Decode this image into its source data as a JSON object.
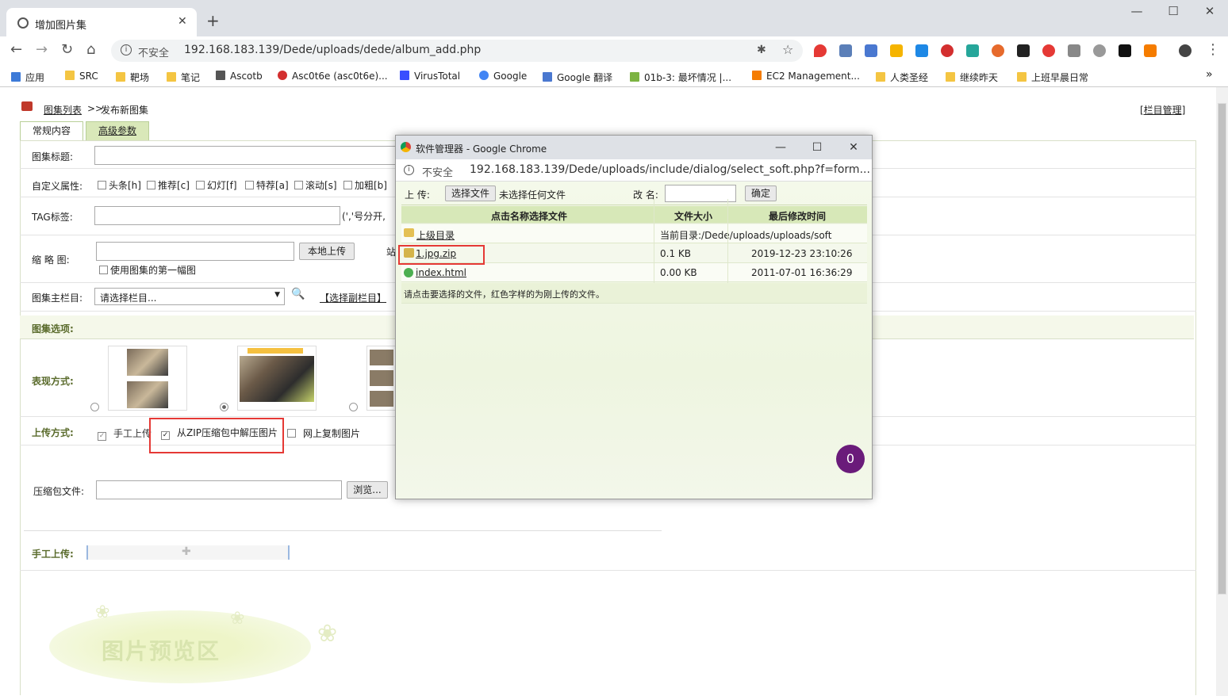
{
  "browser": {
    "tab_title": "增加图片集",
    "new_tab": "+",
    "win_min": "—",
    "win_max": "☐",
    "win_close": "✕",
    "security": "不安全",
    "url": "192.168.183.139/Dede/uploads/dede/album_add.php",
    "bookmarks": [
      "应用",
      "SRC",
      "靶场",
      "笔记",
      "Ascotb",
      "Asc0t6e (asc0t6e)...",
      "VirusTotal",
      "Google",
      "Google 翻译",
      "01b-3: 最坏情况 |...",
      "EC2 Management...",
      "人类圣经",
      "继续昨天",
      "上班早晨日常"
    ],
    "bookmarks_more": "»"
  },
  "page": {
    "breadcrumb_link": "图集列表",
    "breadcrumb_sep": ">>",
    "breadcrumb_current": "发布新图集",
    "column_mgmt": "[栏目管理]",
    "tabs": [
      "常规内容",
      "高级参数"
    ],
    "title_label": "图集标题:",
    "attr_label": "自定义属性:",
    "attrs": [
      "头条[h]",
      "推荐[c]",
      "幻灯[f]",
      "特荐[a]",
      "滚动[s]",
      "加粗[b]"
    ],
    "tag_label": "TAG标签:",
    "tag_hint": "(','号分开,",
    "thumb_label": "缩 略 图:",
    "local_upload": "本地上传",
    "site_btn_partial": "站",
    "use_first": "使用图集的第一幅图",
    "column_label": "图集主栏目:",
    "column_select": "请选择栏目...",
    "sub_column": "【选择副栏目】",
    "options_title": "图集选项:",
    "display_label": "表现方式:",
    "upload_label": "上传方式:",
    "upload_opts": [
      "手工上传",
      "从ZIP压缩包中解压图片",
      "网上复制图片"
    ],
    "zip_label": "压缩包文件:",
    "browse": "浏览...",
    "manual_label": "手工上传:",
    "preview_text": "图片预览区"
  },
  "popup": {
    "title": "软件管理器 - Google Chrome",
    "security": "不安全",
    "url": "192.168.183.139/Dede/uploads/include/dialog/select_soft.php?f=form...",
    "upload_label": "上  传:",
    "choose_file": "选择文件",
    "no_file": "未选择任何文件",
    "rename_label": "改 名:",
    "confirm": "确定",
    "headers": [
      "点击名称选择文件",
      "文件大小",
      "最后修改时间"
    ],
    "parent_dir": "上级目录",
    "current_dir": "当前目录:/Dede/uploads/uploads/soft",
    "files": [
      {
        "name": "1.jpg.zip",
        "size": "0.1 KB",
        "time": "2019-12-23 23:10:26"
      },
      {
        "name": "index.html",
        "size": "0.00 KB",
        "time": "2011-07-01 16:36:29"
      }
    ],
    "note": "请点击要选择的文件，红色字样的为刚上传的文件。",
    "badge": "0"
  }
}
